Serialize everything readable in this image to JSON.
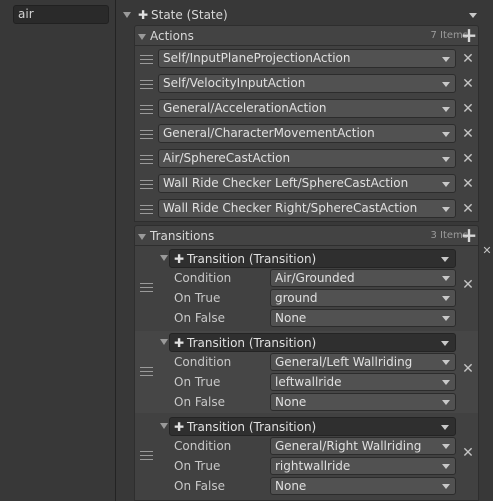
{
  "object_name": "air",
  "state": {
    "title": "State (State)"
  },
  "actions": {
    "title": "Actions",
    "count": "7 Items",
    "items": [
      "Self/InputPlaneProjectionAction",
      "Self/VelocityInputAction",
      "General/AccelerationAction",
      "General/CharacterMovementAction",
      "Air/SphereCastAction",
      "Wall Ride Checker Left/SphereCastAction",
      "Wall Ride Checker Right/SphereCastAction"
    ]
  },
  "transitions": {
    "title": "Transitions",
    "count": "3 Items",
    "labels": {
      "condition": "Condition",
      "on_true": "On True",
      "on_false": "On False"
    },
    "items": [
      {
        "title": "Transition (Transition)",
        "condition": "Air/Grounded",
        "on_true": "ground",
        "on_false": "None"
      },
      {
        "title": "Transition (Transition)",
        "condition": "General/Left Wallriding",
        "on_true": "leftwallride",
        "on_false": "None"
      },
      {
        "title": "Transition (Transition)",
        "condition": "General/Right Wallriding",
        "on_true": "rightwallride",
        "on_false": "None"
      }
    ]
  },
  "icons": {
    "add": "plus-icon",
    "remove": "x-icon",
    "component": "puzzle-icon",
    "drag": "drag-handle-icon"
  },
  "symbols": {
    "add": "+",
    "remove": "✕",
    "component": "✚"
  },
  "colors": {
    "background": "#383838",
    "field": "#515151",
    "header": "#2f2f2f"
  }
}
